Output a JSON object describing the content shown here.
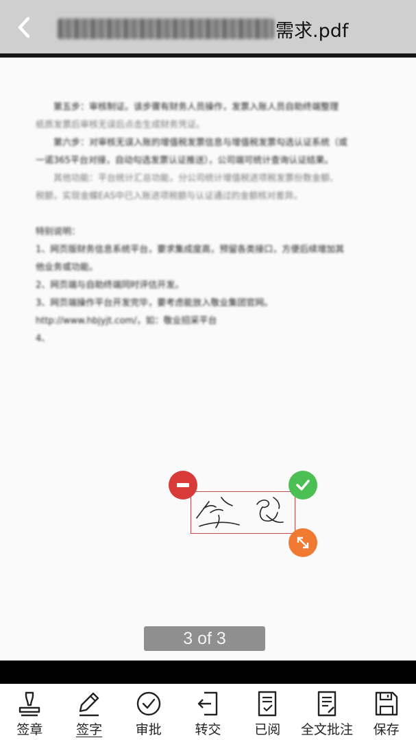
{
  "header": {
    "title_suffix": "需求.pdf"
  },
  "document": {
    "lines": [
      {
        "text": "第五步：审核制证。该步骤有财务人员操作，发票入账人员自助终端整理",
        "indent": true,
        "dim": false
      },
      {
        "text": "纸质发票后审核无误后点击生成财务凭证。",
        "indent": false,
        "dim": true
      },
      {
        "text": "第六步：对审核无误入账的增值税发票信息与增值税发票勾选认证系统（或",
        "indent": true,
        "dim": false
      },
      {
        "text": "一诺365平台对接，自动勾选发票认证推送），公司端可统计查询认证结果。",
        "indent": false,
        "dim": false
      },
      {
        "text": "其他功能：平台统计汇总功能，分公司统计增值税进项税发票份数金额、",
        "indent": true,
        "dim": true
      },
      {
        "text": "税额，实现金蝶EAS中已入账进项税额与认证通过的金额核对差异。",
        "indent": false,
        "dim": true
      },
      {
        "text": "",
        "indent": false,
        "dim": false
      },
      {
        "text": "特别说明：",
        "indent": false,
        "dim": false
      },
      {
        "text": "1、网页版财务信息系统平台，要求集成度高，预留各类接口，方便后续增加其",
        "indent": false,
        "dim": false
      },
      {
        "text": "他业务或功能。",
        "indent": false,
        "dim": false
      },
      {
        "text": "2、网页端与自助终端同时评估开发。",
        "indent": false,
        "dim": false
      },
      {
        "text": "3、网页端操作平台开发完毕，要考虑能放入敬业集团官网。",
        "indent": false,
        "dim": false
      },
      {
        "text": "http://www.hbjyjt.com/，如：敬业招采平台",
        "indent": false,
        "dim": false
      },
      {
        "text": "4、",
        "indent": false,
        "dim": false
      }
    ]
  },
  "signature": {
    "remove_icon": "minus-circle-icon",
    "confirm_icon": "check-circle-icon",
    "resize_icon": "resize-arrows-icon"
  },
  "page_indicator": "3 of 3",
  "toolbar": {
    "items": [
      {
        "label": "签章",
        "icon": "stamp-icon"
      },
      {
        "label": "签字",
        "icon": "pen-icon"
      },
      {
        "label": "审批",
        "icon": "check-circle-outline-icon"
      },
      {
        "label": "转交",
        "icon": "transfer-icon"
      },
      {
        "label": "已阅",
        "icon": "read-document-icon"
      },
      {
        "label": "全文批注",
        "icon": "annotate-document-icon"
      },
      {
        "label": "保存",
        "icon": "save-icon"
      }
    ]
  },
  "colors": {
    "header_bg": "#cfcfcf",
    "remove": "#d83a3a",
    "confirm": "#4cbf54",
    "resize": "#f07a32",
    "signature_border": "#c24a4a"
  }
}
